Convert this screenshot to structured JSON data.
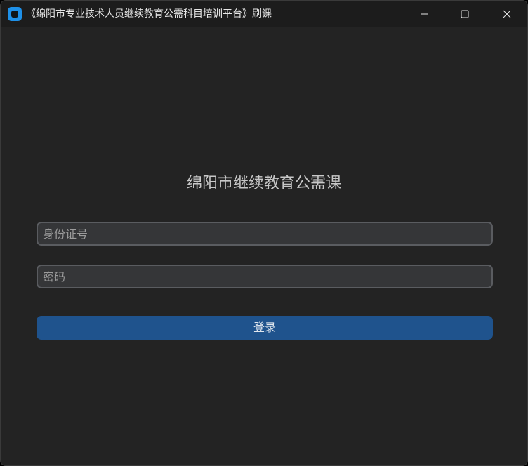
{
  "window": {
    "title": "《绵阳市专业技术人员继续教育公需科目培训平台》刷课",
    "icon": "app-icon",
    "controls": [
      "minimize-icon",
      "maximize-icon",
      "close-icon"
    ]
  },
  "form": {
    "heading": "绵阳市继续教育公需课",
    "id_field": {
      "placeholder": "身份证号",
      "value": ""
    },
    "password_field": {
      "placeholder": "密码",
      "value": ""
    },
    "login_label": "登录"
  },
  "colors": {
    "background": "#232323",
    "titlebar": "#1c1c1c",
    "field_bg": "#353638",
    "field_border": "#5a5c60",
    "button": "#1f538d",
    "app_icon": "#1e90e8"
  }
}
